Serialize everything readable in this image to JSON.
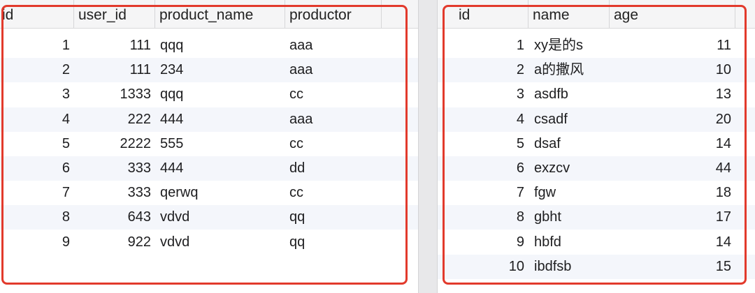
{
  "left_table": {
    "columns": [
      "id",
      "user_id",
      "product_name",
      "productor"
    ],
    "rows": [
      {
        "id": "1",
        "user_id": "111",
        "product_name": "qqq",
        "productor": "aaa"
      },
      {
        "id": "2",
        "user_id": "111",
        "product_name": "234",
        "productor": "aaa"
      },
      {
        "id": "3",
        "user_id": "1333",
        "product_name": "qqq",
        "productor": "cc"
      },
      {
        "id": "4",
        "user_id": "222",
        "product_name": "444",
        "productor": "aaa"
      },
      {
        "id": "5",
        "user_id": "2222",
        "product_name": "555",
        "productor": "cc"
      },
      {
        "id": "6",
        "user_id": "333",
        "product_name": "444",
        "productor": "dd"
      },
      {
        "id": "7",
        "user_id": "333",
        "product_name": "qerwq",
        "productor": "cc"
      },
      {
        "id": "8",
        "user_id": "643",
        "product_name": "vdvd",
        "productor": "qq"
      },
      {
        "id": "9",
        "user_id": "922",
        "product_name": "vdvd",
        "productor": "qq"
      }
    ]
  },
  "right_table": {
    "columns": [
      "id",
      "name",
      "age"
    ],
    "rows": [
      {
        "id": "1",
        "name": "xy是的s",
        "age": "11"
      },
      {
        "id": "2",
        "name": "a的撒风",
        "age": "10"
      },
      {
        "id": "3",
        "name": "asdfb",
        "age": "13"
      },
      {
        "id": "4",
        "name": "csadf",
        "age": "20"
      },
      {
        "id": "5",
        "name": "dsaf",
        "age": "14"
      },
      {
        "id": "6",
        "name": "exzcv",
        "age": "44"
      },
      {
        "id": "7",
        "name": "fgw",
        "age": "18"
      },
      {
        "id": "8",
        "name": "gbht",
        "age": "17"
      },
      {
        "id": "9",
        "name": "hbfd",
        "age": "14"
      },
      {
        "id": "10",
        "name": "ibdfsb",
        "age": "15"
      }
    ]
  },
  "colors": {
    "highlight_frame": "#e23a2c",
    "alt_row": "#f4f6fb",
    "header_bg": "#f5f5f6"
  }
}
